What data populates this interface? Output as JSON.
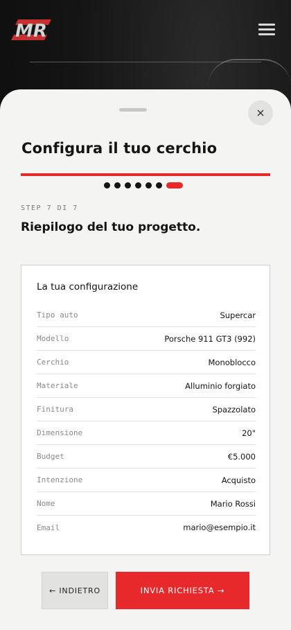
{
  "brand": {
    "logo_text": "MR",
    "accent": "#e8292b"
  },
  "header": {
    "menu_icon": "hamburger-menu-icon"
  },
  "sheet": {
    "title": "Configura il tuo cerchio",
    "close_icon": "close-icon",
    "progress": {
      "total_steps": 7,
      "current_step": 7
    },
    "step_label": "STEP 7 DI 7",
    "step_title": "Riepilogo del tuo progetto.",
    "summary": {
      "title": "La tua configurazione",
      "rows": [
        {
          "label": "Tipo auto",
          "value": "Supercar"
        },
        {
          "label": "Modello",
          "value": "Porsche 911 GT3 (992)"
        },
        {
          "label": "Cerchio",
          "value": "Monoblocco"
        },
        {
          "label": "Materiale",
          "value": "Alluminio forgiato"
        },
        {
          "label": "Finitura",
          "value": "Spazzolato"
        },
        {
          "label": "Dimensione",
          "value": "20\""
        },
        {
          "label": "Budget",
          "value": "€5.000"
        },
        {
          "label": "Intenzione",
          "value": "Acquisto"
        },
        {
          "label": "Nome",
          "value": "Mario Rossi"
        },
        {
          "label": "Email",
          "value": "mario@esempio.it"
        }
      ]
    },
    "actions": {
      "back_label": "← INDIETRO",
      "submit_label": "INVIA RICHIESTA →"
    }
  }
}
